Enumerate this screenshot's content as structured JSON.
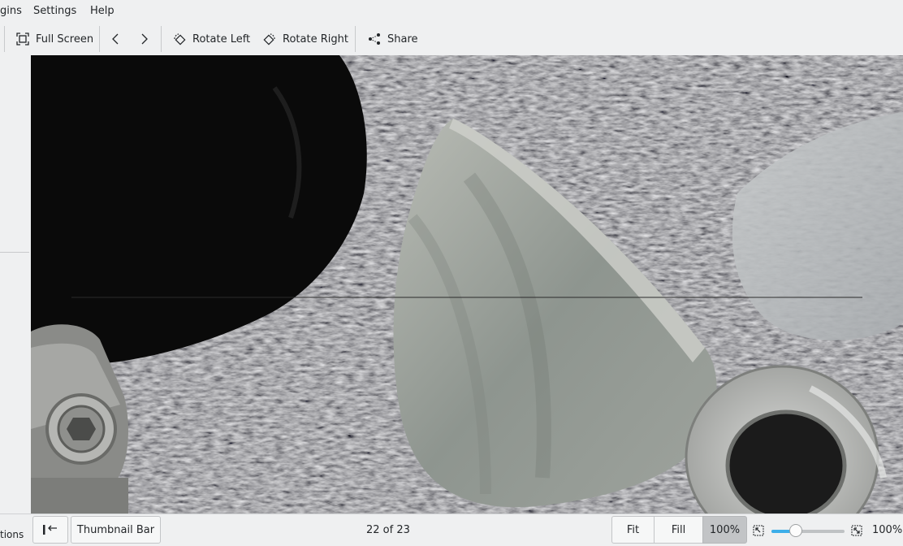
{
  "menubar": {
    "items": [
      "gins",
      "Settings",
      "Help"
    ]
  },
  "toolbar": {
    "full_screen": "Full Screen",
    "rotate_left": "Rotate Left",
    "rotate_right": "Rotate Right",
    "share": "Share"
  },
  "sidebar": {
    "bottom_label": "tions"
  },
  "statusbar": {
    "thumbnail_bar": "Thumbnail Bar",
    "position": "22 of 23",
    "fit": "Fit",
    "fill": "Fill",
    "zoom_button": "100%",
    "zoom_level": "100%",
    "zoom_slider_fraction": 0.33
  },
  "colors": {
    "accent": "#3daee9",
    "selected_segment": "#c2c4c6"
  },
  "icons": [
    "full-screen-icon",
    "back-icon",
    "forward-icon",
    "rotate-left-icon",
    "rotate-right-icon",
    "share-icon",
    "toggle-sidebar-icon",
    "zoom-out-icon",
    "zoom-in-icon"
  ]
}
